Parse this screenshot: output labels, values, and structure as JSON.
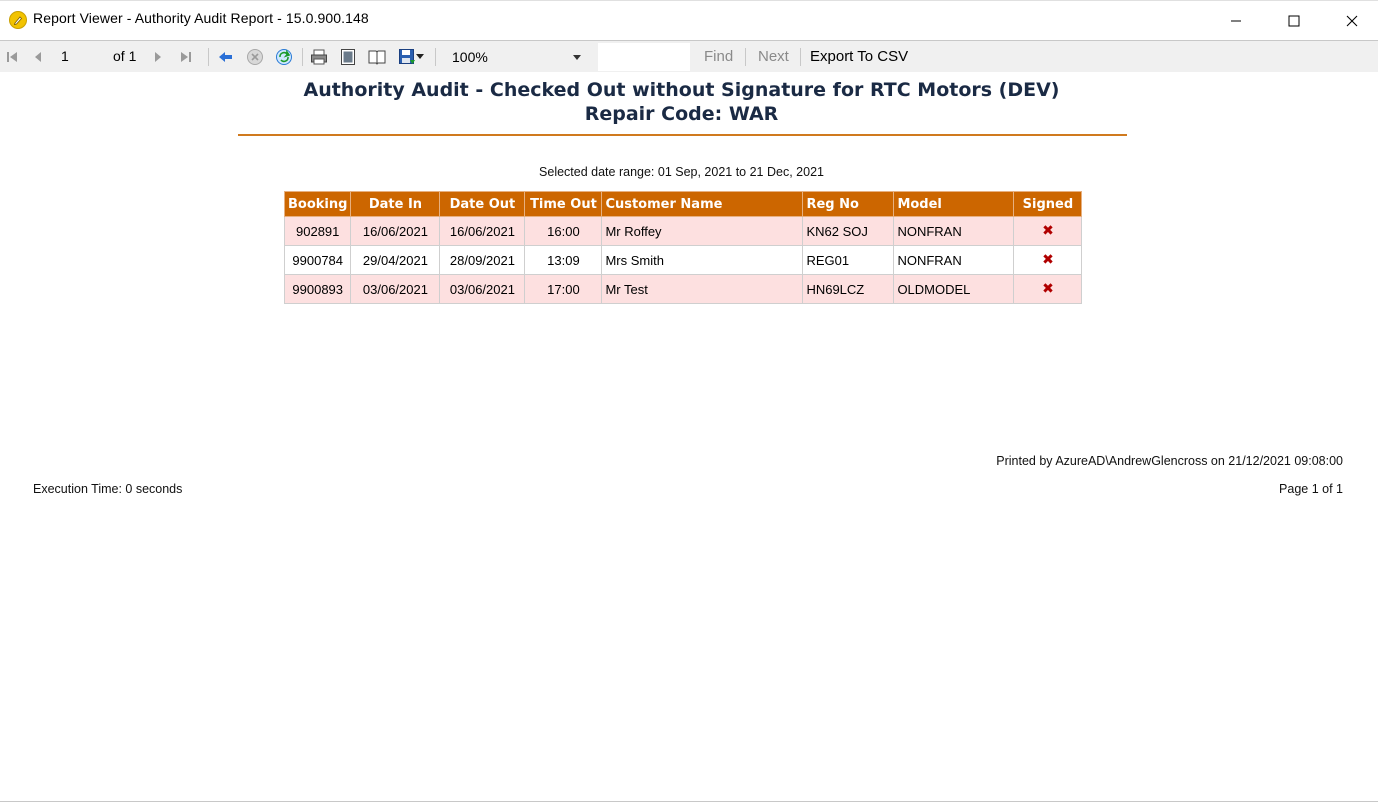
{
  "window": {
    "title": "Report Viewer - Authority Audit Report - 15.0.900.148"
  },
  "toolbar": {
    "current_page": "1",
    "of_label": "of",
    "total_pages": "1",
    "zoom": "100%",
    "find_label": "Find",
    "next_label": "Next",
    "export_label": "Export To CSV"
  },
  "report": {
    "title_line1": "Authority Audit - Checked Out without Signature for RTC Motors (DEV)",
    "title_line2": "Repair Code: WAR",
    "date_range": "Selected date range: 01 Sep, 2021 to 21 Dec, 2021",
    "columns": [
      "Booking",
      "Date In",
      "Date Out",
      "Time Out",
      "Customer Name",
      "Reg No",
      "Model",
      "Signed"
    ],
    "rows": [
      {
        "booking": "902891",
        "date_in": "16/06/2021",
        "date_out": "16/06/2021",
        "time_out": "16:00",
        "customer": "Mr Roffey",
        "reg": "KN62 SOJ",
        "model": "NONFRAN",
        "signed": "✖"
      },
      {
        "booking": "9900784",
        "date_in": "29/04/2021",
        "date_out": "28/09/2021",
        "time_out": "13:09",
        "customer": "Mrs Smith",
        "reg": "REG01",
        "model": "NONFRAN",
        "signed": "✖"
      },
      {
        "booking": "9900893",
        "date_in": "03/06/2021",
        "date_out": "03/06/2021",
        "time_out": "17:00",
        "customer": "Mr Test",
        "reg": "HN69LCZ",
        "model": "OLDMODEL",
        "signed": "✖"
      }
    ],
    "printed_by": "Printed by AzureAD\\AndrewGlencross on 21/12/2021 09:08:00",
    "execution_time": "Execution Time: 0 seconds",
    "page_info": "Page 1 of 1"
  },
  "colors": {
    "header_bg": "#cc6600",
    "odd_row_bg": "#fde0e0",
    "rule": "#d07a1e",
    "x_mark": "#b00000"
  }
}
